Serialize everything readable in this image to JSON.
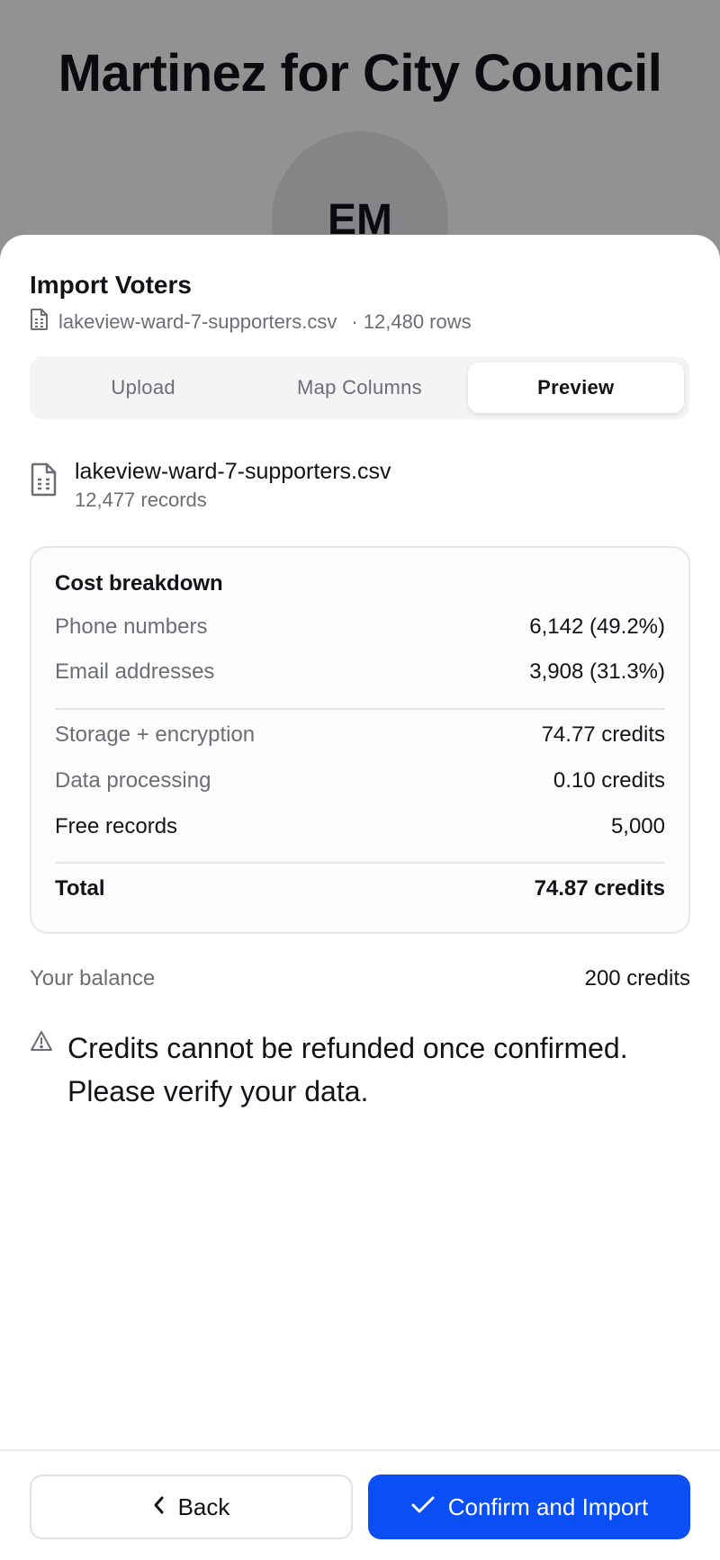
{
  "background": {
    "title": "Martinez for City Council",
    "avatar_initials": "EM"
  },
  "sheet": {
    "title": "Import Voters",
    "file_name": "lakeview-ward-7-supporters.csv",
    "row_count": "· 12,480 rows",
    "tabs": [
      {
        "label": "Upload",
        "active": false
      },
      {
        "label": "Map Columns",
        "active": false
      },
      {
        "label": "Preview",
        "active": true
      }
    ],
    "file_info": {
      "name": "lakeview-ward-7-supporters.csv",
      "records": "12,477 records"
    },
    "cost": {
      "title": "Cost breakdown",
      "phone_label": "Phone numbers",
      "phone_value": "6,142 (49.2%)",
      "email_label": "Email addresses",
      "email_value": "3,908 (31.3%)",
      "storage_label": "Storage + encryption",
      "storage_value": "74.77 credits",
      "processing_label": "Data processing",
      "processing_value": "0.10 credits",
      "free_label": "Free records",
      "free_value": "5,000",
      "total_label": "Total",
      "total_value": "74.87 credits"
    },
    "balance": {
      "label": "Your balance",
      "value": "200 credits"
    },
    "warning": "Credits cannot be refunded once confirmed. Please verify your data.",
    "footer": {
      "back_label": "Back",
      "confirm_label": "Confirm and Import"
    }
  },
  "colors": {
    "accent": "#0a4ff5",
    "muted_text": "#6b6e75",
    "text": "#111318"
  },
  "icons": [
    "file-icon",
    "warning-triangle-icon",
    "chevron-left-icon",
    "check-icon"
  ]
}
